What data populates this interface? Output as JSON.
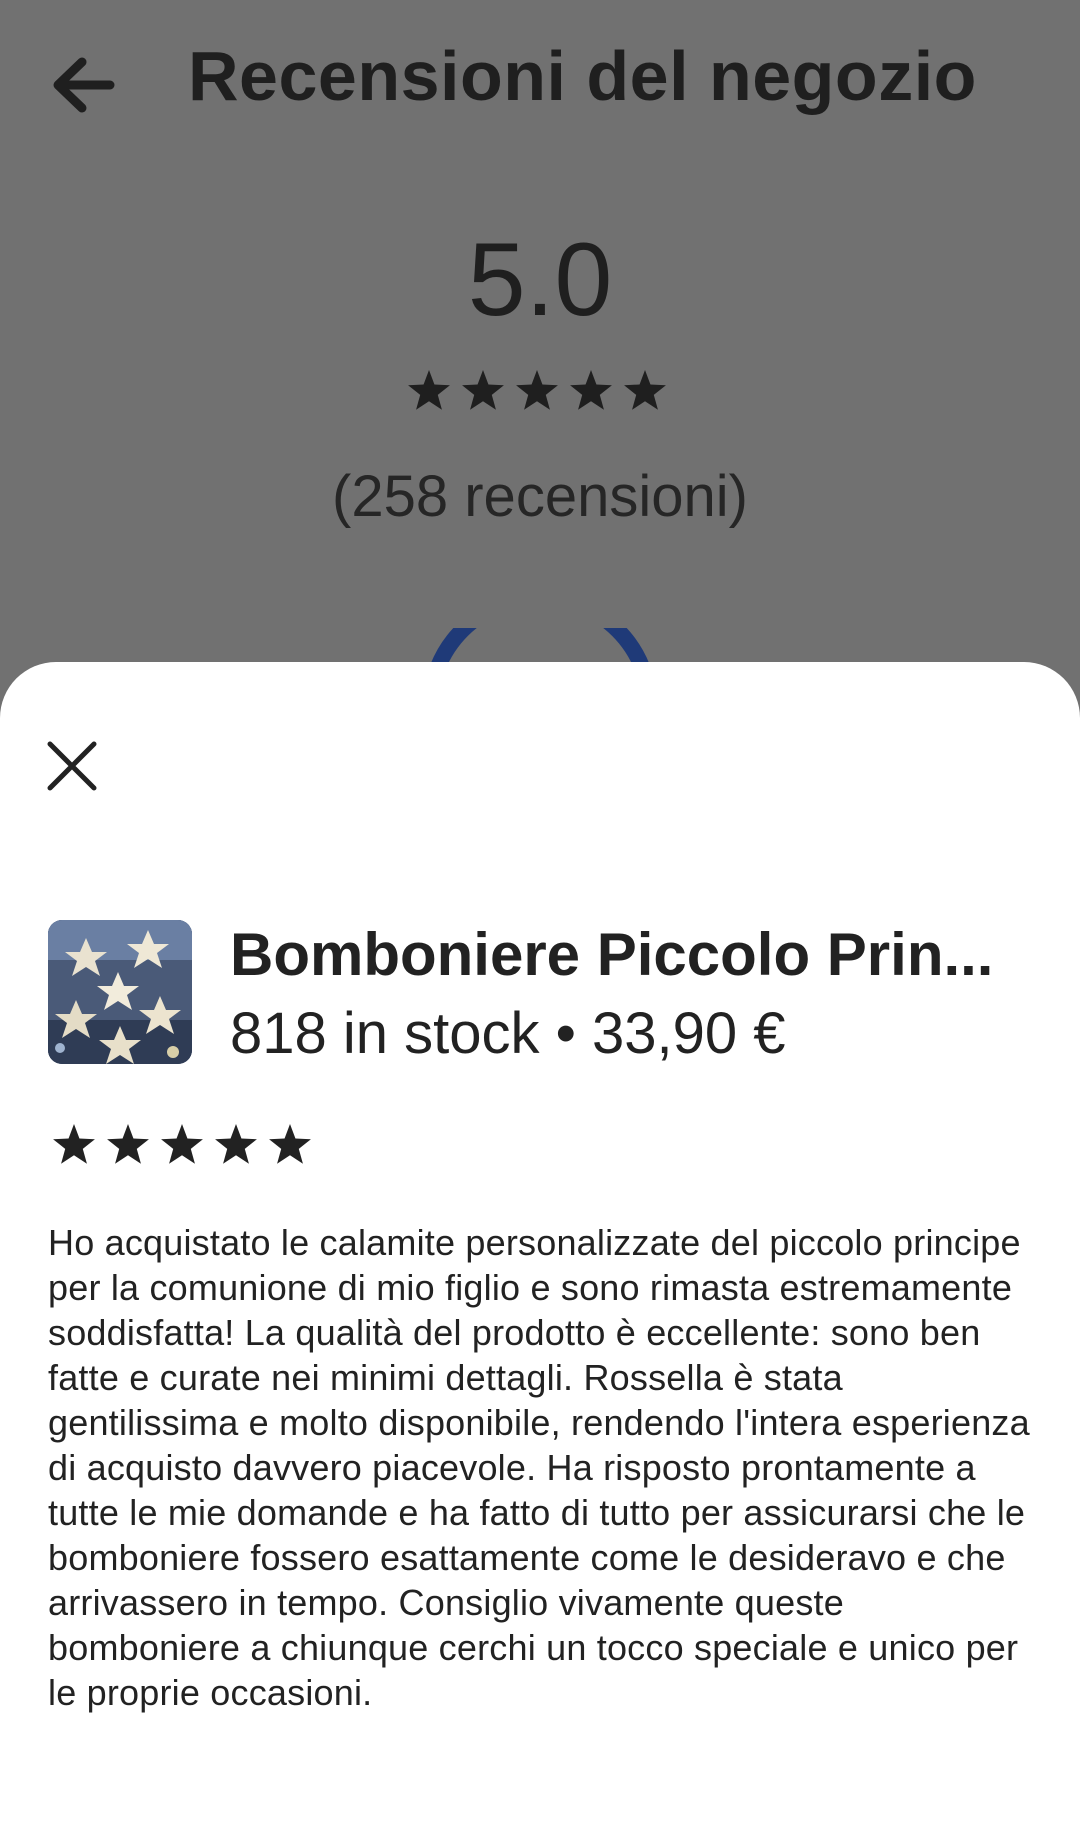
{
  "header": {
    "title": "Recensioni del negozio",
    "back_icon": "arrow-left-icon"
  },
  "summary": {
    "rating": "5.0",
    "stars": 5,
    "count_text": "(258 recensioni)",
    "ring_color": "#1f3a78"
  },
  "sheet": {
    "close_icon": "close-icon",
    "product": {
      "title": "Bomboniere Piccolo Prin...",
      "meta": "818 in stock • 33,90 €"
    },
    "review": {
      "stars": 5,
      "text": "Ho acquistato le calamite personalizzate del piccolo principe per la comunione di mio figlio e sono rimasta estremamente soddisfatta! La qualità del prodotto è eccellente: sono ben fatte e curate nei minimi dettagli. Rossella è stata gentilissima e molto disponibile, rendendo l'intera esperienza di acquisto davvero piacevole. Ha risposto prontamente a tutte le mie domande e ha fatto di tutto per assicurarsi che le bomboniere fossero esattamente come le desideravo e che arrivassero in tempo. Consiglio vivamente queste bomboniere a chiunque cerchi un tocco speciale e unico per le proprie occasioni."
    }
  },
  "colors": {
    "overlay_bg": "#717171",
    "text_dark": "#222222",
    "star_color": "#222222"
  }
}
